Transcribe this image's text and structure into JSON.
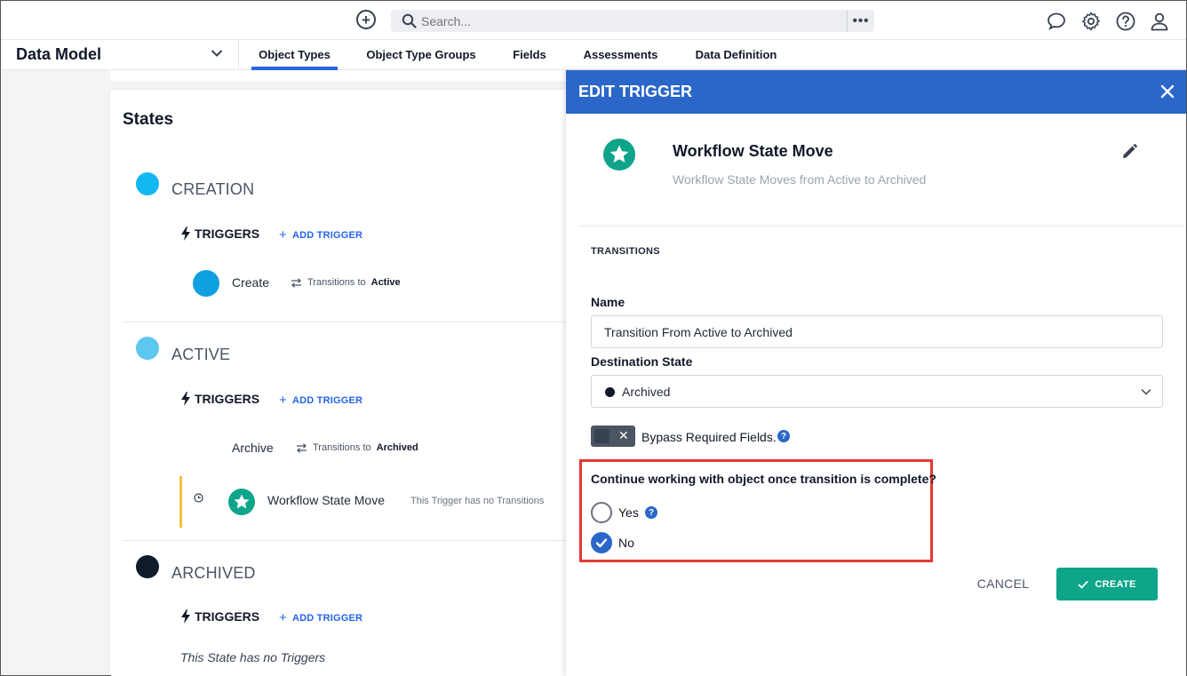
{
  "search": {
    "placeholder": "Search...",
    "more": "•••"
  },
  "nav": {
    "module": "Data Model",
    "tabs": [
      "Object Types",
      "Object Type Groups",
      "Fields",
      "Assessments",
      "Data Definition"
    ],
    "active_tab": "Object Types"
  },
  "states": {
    "title": "States",
    "items": [
      {
        "name": "CREATION",
        "color": "#14b8f0",
        "triggers_label": "TRIGGERS",
        "add_trigger": "ADD TRIGGER",
        "transition": {
          "name": "Create",
          "prefix": "Transitions to",
          "target": "Active"
        }
      },
      {
        "name": "ACTIVE",
        "color": "#5cc7ef",
        "triggers_label": "TRIGGERS",
        "add_trigger": "ADD TRIGGER",
        "transition": {
          "name": "Archive",
          "prefix": "Transitions to",
          "target": "Archived"
        },
        "trigger": {
          "name": "Workflow State Move",
          "note": "This Trigger has no Transitions"
        }
      },
      {
        "name": "ARCHIVED",
        "color": "#0f1b2a",
        "triggers_label": "TRIGGERS",
        "add_trigger": "ADD TRIGGER",
        "empty_text": "This State has no Triggers"
      }
    ]
  },
  "panel": {
    "title": "EDIT TRIGGER",
    "trigger_name": "Workflow State Move",
    "trigger_desc": "Workflow State Moves from Active to Archived",
    "section": "TRANSITIONS",
    "name_label": "Name",
    "name_value": "Transition From Active to Archived",
    "dest_label": "Destination State",
    "dest_value": "Archived",
    "bypass_label": "Bypass Required Fields.",
    "bypass_on": false,
    "question": "Continue working with object once transition is complete?",
    "options": [
      {
        "label": "Yes",
        "checked": false
      },
      {
        "label": "No",
        "checked": true
      }
    ],
    "cancel": "CANCEL",
    "create": "CREATE",
    "colors": {
      "header": "#2a67c9",
      "create": "#0ea58a",
      "highlight": "#e53935"
    }
  }
}
